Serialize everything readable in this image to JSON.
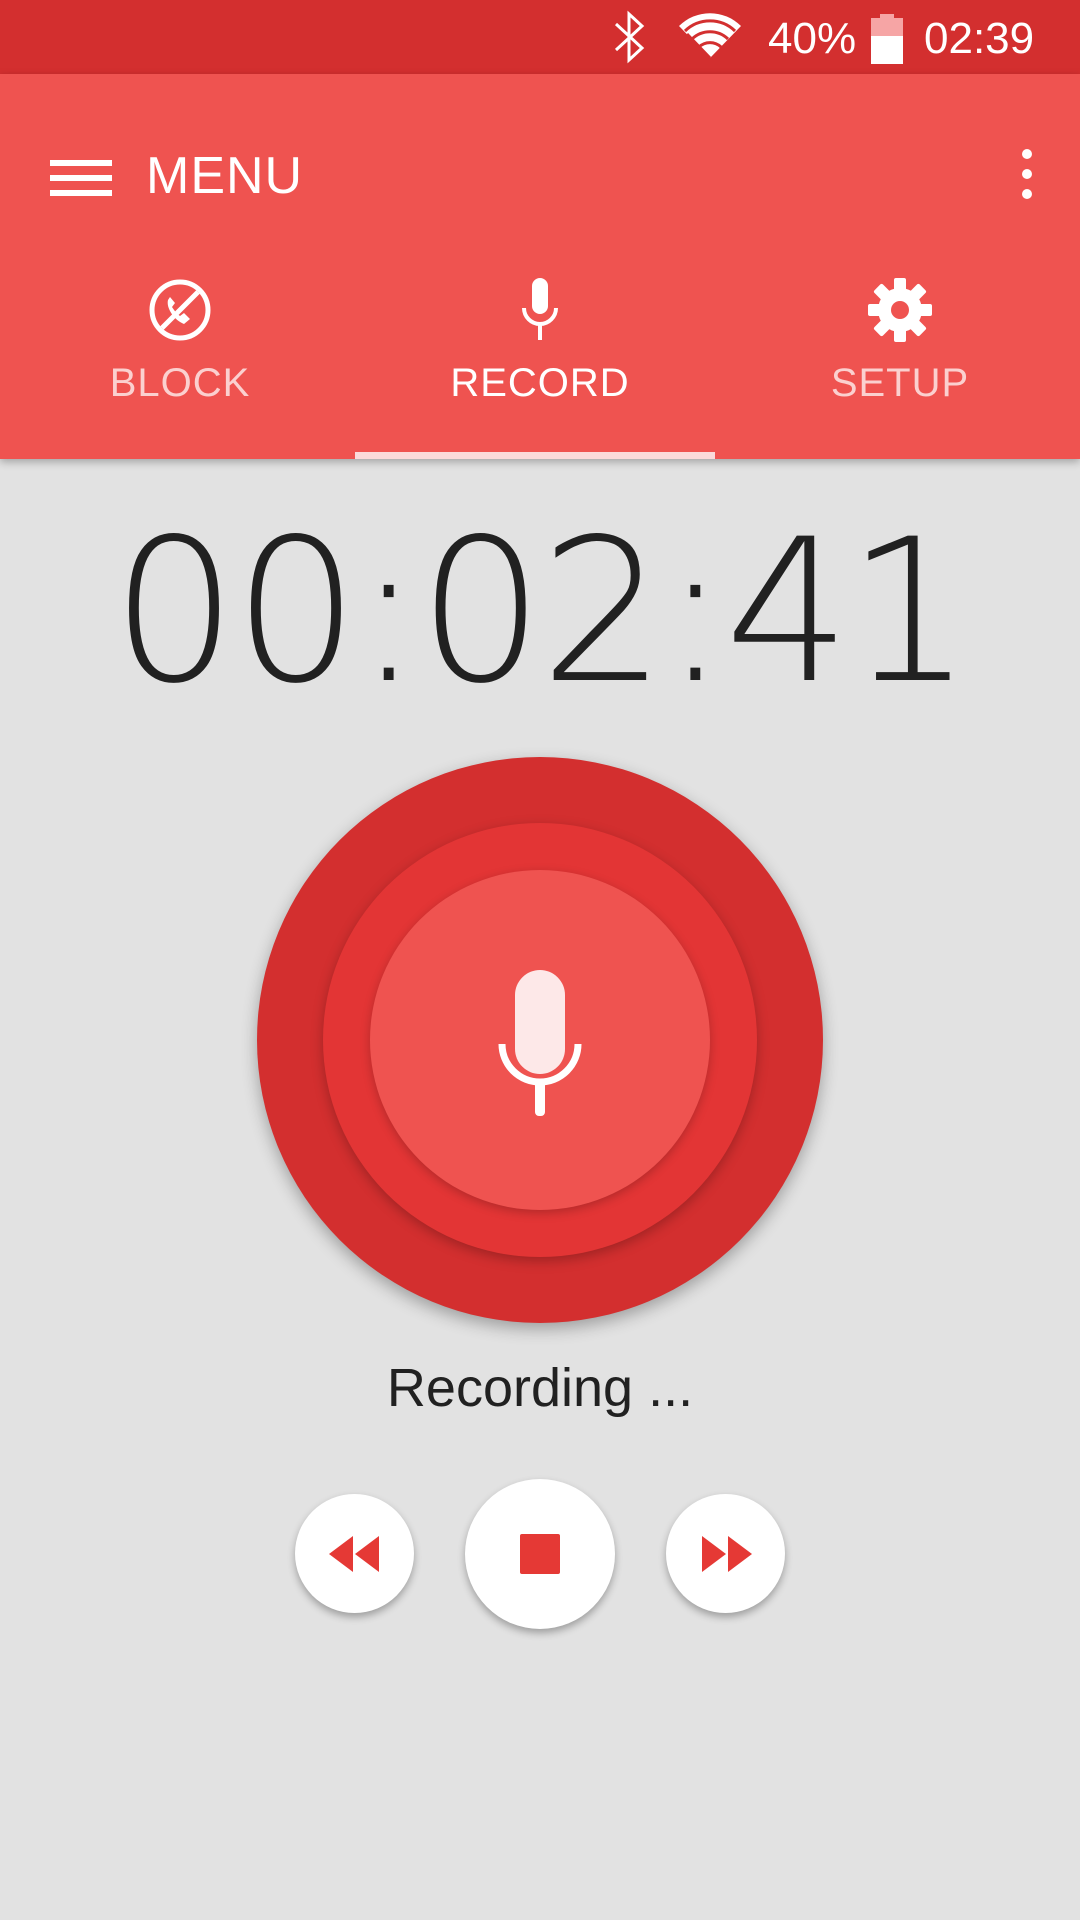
{
  "status_bar": {
    "battery_percent": "40%",
    "time": "02:39",
    "icons": [
      "bluetooth-icon",
      "wifi-icon",
      "battery-icon"
    ],
    "battery_level": 0.4
  },
  "app_bar": {
    "title": "MENU",
    "menu_icon": "hamburger-icon",
    "overflow_icon": "more-vert-icon"
  },
  "tabs": [
    {
      "label": "BLOCK",
      "icon": "block-call-icon",
      "active": false
    },
    {
      "label": "RECORD",
      "icon": "microphone-icon",
      "active": true
    },
    {
      "label": "SETUP",
      "icon": "gear-icon",
      "active": false
    }
  ],
  "recorder": {
    "elapsed": "00:02:41",
    "status": "Recording ...",
    "record_icon": "microphone-icon"
  },
  "controls": [
    {
      "name": "rewind",
      "icon": "rewind-icon"
    },
    {
      "name": "stop",
      "icon": "stop-icon"
    },
    {
      "name": "forward",
      "icon": "fast-forward-icon"
    }
  ],
  "colors": {
    "status_bar": "#d32f2f",
    "app_bar": "#ef5350",
    "accent": "#e53935",
    "background": "#e2e2e2"
  }
}
